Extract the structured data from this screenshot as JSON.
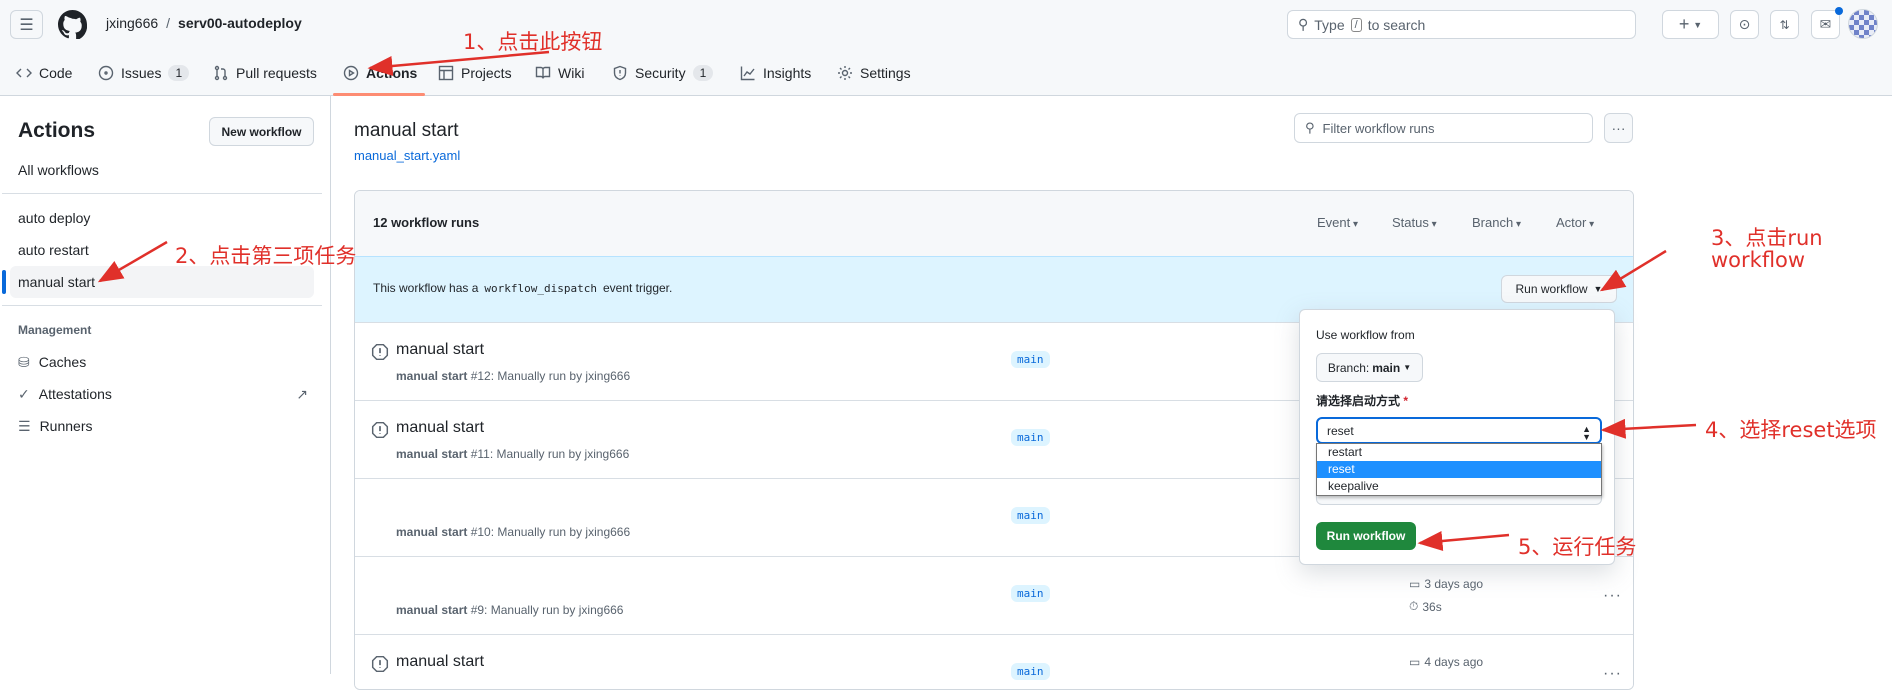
{
  "header": {
    "owner": "jxing666",
    "separator": "/",
    "repo": "serv00-autodeploy",
    "search_placeholder": "Type / to search",
    "search_pre": "Type",
    "search_key": "/",
    "search_post": "to search"
  },
  "tabs": [
    {
      "label": "Code",
      "icon": "code-icon"
    },
    {
      "label": "Issues",
      "count": "1",
      "icon": "issue-icon"
    },
    {
      "label": "Pull requests",
      "icon": "pull-request-icon"
    },
    {
      "label": "Actions",
      "icon": "play-icon",
      "active": true
    },
    {
      "label": "Projects",
      "icon": "table-icon"
    },
    {
      "label": "Wiki",
      "icon": "book-icon"
    },
    {
      "label": "Security",
      "count": "1",
      "icon": "shield-icon"
    },
    {
      "label": "Insights",
      "icon": "graph-icon"
    },
    {
      "label": "Settings",
      "icon": "gear-icon"
    }
  ],
  "sidebar": {
    "title": "Actions",
    "new_workflow": "New workflow",
    "all_workflows": "All workflows",
    "workflows": [
      "auto deploy",
      "auto restart",
      "manual start"
    ],
    "management_title": "Management",
    "management": [
      "Caches",
      "Attestations",
      "Runners"
    ]
  },
  "main": {
    "title": "manual start",
    "file_link": "manual_start.yaml",
    "filter_placeholder": "Filter workflow runs",
    "runs_count": "12 workflow runs",
    "filters": [
      "Event",
      "Status",
      "Branch",
      "Actor"
    ],
    "banner": {
      "pre": "This workflow has a",
      "code": "workflow_dispatch",
      "post": "event trigger.",
      "run_button": "Run workflow"
    },
    "runs": [
      {
        "title": "manual start",
        "name": "manual start",
        "desc": "#12: Manually run by jxing666",
        "branch": "main"
      },
      {
        "title": "manual start",
        "name": "manual start",
        "desc": "#11: Manually run by jxing666",
        "branch": "main"
      },
      {
        "title": "",
        "name": "manual start",
        "desc": "#10: Manually run by jxing666",
        "branch": "main"
      },
      {
        "title": "",
        "name": "manual start",
        "desc": "#9: Manually run by jxing666",
        "branch": "main",
        "time": "3 days ago",
        "duration": "36s"
      },
      {
        "title": "manual start",
        "name": "",
        "desc": "",
        "branch": "main",
        "time": "4 days ago"
      }
    ]
  },
  "popup": {
    "use_from": "Use workflow from",
    "branch_label": "Branch:",
    "branch_value": "main",
    "input_label": "请选择启动方式",
    "required": "*",
    "selected": "reset",
    "options": [
      "restart",
      "reset",
      "keepalive"
    ],
    "submit": "Run workflow"
  },
  "annotations": [
    "1、点击此按钮",
    "2、点击第三项任务",
    "3、点击run",
    "workflow",
    "4、选择reset选项",
    "5、运行任务"
  ],
  "colors": {
    "accent": "#0969da",
    "annotation": "#e0302a",
    "run_button": "#1f883d",
    "active_tab_underline": "#fd8c73",
    "banner": "#ddf4ff"
  }
}
